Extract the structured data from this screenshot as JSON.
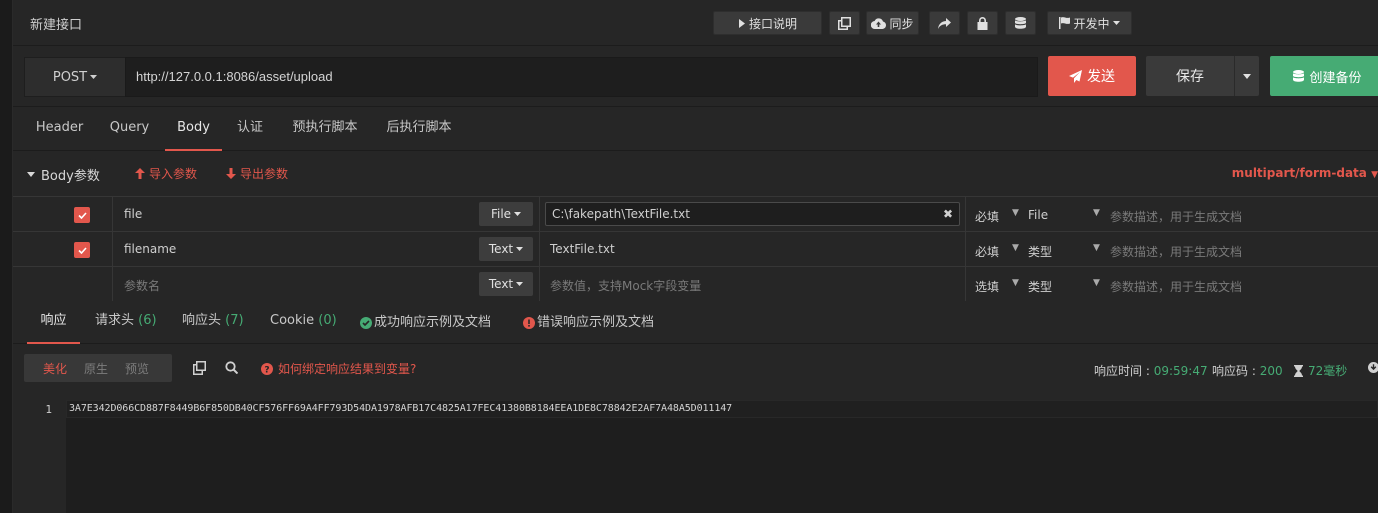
{
  "title": "新建接口",
  "toolbar": {
    "doc_label": "接口说明",
    "sync_label": "同步",
    "status_label": "开发中"
  },
  "request": {
    "method": "POST",
    "url": "http://127.0.0.1:8086/asset/upload",
    "send_label": "发送",
    "save_label": "保存",
    "backup_label": "创建备份"
  },
  "tabs": [
    "Header",
    "Query",
    "Body",
    "认证",
    "预执行脚本",
    "后执行脚本"
  ],
  "active_tab": "Body",
  "body": {
    "section_label": "Body参数",
    "import_label": "导入参数",
    "export_label": "导出参数",
    "content_type": "multipart/form-data",
    "params": [
      {
        "checked": true,
        "name": "file",
        "type": "File",
        "value": "C:\\fakepath\\TextFile.txt",
        "required": "必填",
        "param_type": "File",
        "desc_placeholder": "参数描述，用于生成文档"
      },
      {
        "checked": true,
        "name": "filename",
        "type": "Text",
        "value": "TextFile.txt",
        "required": "必填",
        "param_type": "类型",
        "desc_placeholder": "参数描述，用于生成文档"
      },
      {
        "checked": false,
        "name_placeholder": "参数名",
        "type": "Text",
        "value_placeholder": "参数值，支持Mock字段变量",
        "required": "选填",
        "param_type": "类型",
        "desc_placeholder": "参数描述，用于生成文档"
      }
    ]
  },
  "response": {
    "tabs": {
      "response": "响应",
      "req_headers": "请求头",
      "req_headers_count": "(6)",
      "resp_headers": "响应头",
      "resp_headers_count": "(7)",
      "cookie": "Cookie",
      "cookie_count": "(0)",
      "success_docs": "成功响应示例及文档",
      "error_docs": "错误响应示例及文档"
    },
    "view_modes": [
      "美化",
      "原生",
      "预览"
    ],
    "active_view": "美化",
    "help_link": "如何绑定响应结果到变量?",
    "time_label": "响应时间 :",
    "time_value": "09:59:47",
    "code_label": "响应码 :",
    "code_value": "200",
    "duration": "72毫秒",
    "line_number": "1",
    "body_text": "3A7E342D066CD887F8449B6F850DB40CF576FF69A4FF793D54DA1978AFB17C4825A17FEC41380B8184EEA1DE8C78842E2AF7A48A5D011147"
  },
  "colors": {
    "accent": "#e2574c",
    "success": "#46ab74",
    "background": "#262626"
  }
}
